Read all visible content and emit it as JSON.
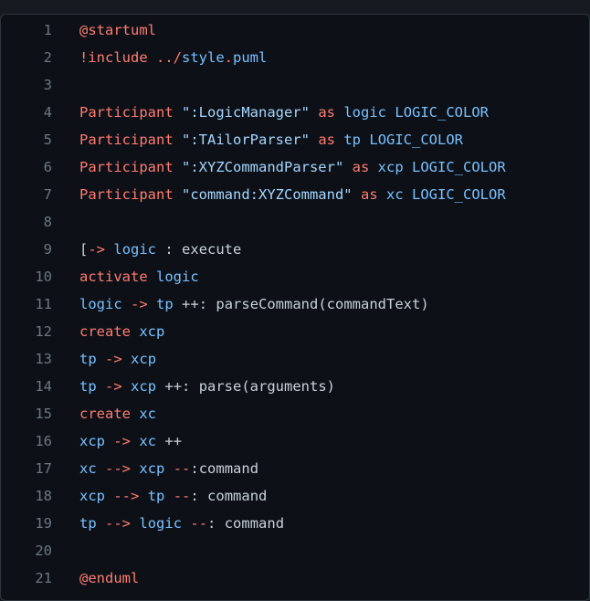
{
  "editor": {
    "language": "plantuml",
    "colors": {
      "background": "#0d1117",
      "keyword": "#ff7b72",
      "identifier": "#79c0ff",
      "string": "#a5d6ff",
      "default": "#c9d1d9",
      "line_number": "#6e7681"
    },
    "lines": [
      {
        "n": "1",
        "tokens": [
          {
            "t": "@startuml",
            "c": "k"
          }
        ]
      },
      {
        "n": "2",
        "tokens": [
          {
            "t": "!include",
            "c": "k"
          },
          {
            "t": " ",
            "c": "d"
          },
          {
            "t": "../",
            "c": "k"
          },
          {
            "t": "style",
            "c": "b"
          },
          {
            "t": ".",
            "c": "k"
          },
          {
            "t": "puml",
            "c": "b"
          }
        ]
      },
      {
        "n": "3",
        "tokens": []
      },
      {
        "n": "4",
        "tokens": [
          {
            "t": "Participant",
            "c": "k"
          },
          {
            "t": " ",
            "c": "d"
          },
          {
            "t": "\":LogicManager\"",
            "c": "s"
          },
          {
            "t": " ",
            "c": "d"
          },
          {
            "t": "as",
            "c": "k"
          },
          {
            "t": " ",
            "c": "d"
          },
          {
            "t": "logic",
            "c": "b"
          },
          {
            "t": " ",
            "c": "d"
          },
          {
            "t": "LOGIC_COLOR",
            "c": "b"
          }
        ]
      },
      {
        "n": "5",
        "tokens": [
          {
            "t": "Participant",
            "c": "k"
          },
          {
            "t": " ",
            "c": "d"
          },
          {
            "t": "\":TAilorParser\"",
            "c": "s"
          },
          {
            "t": " ",
            "c": "d"
          },
          {
            "t": "as",
            "c": "k"
          },
          {
            "t": " ",
            "c": "d"
          },
          {
            "t": "tp",
            "c": "b"
          },
          {
            "t": " ",
            "c": "d"
          },
          {
            "t": "LOGIC_COLOR",
            "c": "b"
          }
        ]
      },
      {
        "n": "6",
        "tokens": [
          {
            "t": "Participant",
            "c": "k"
          },
          {
            "t": " ",
            "c": "d"
          },
          {
            "t": "\":XYZCommandParser\"",
            "c": "s"
          },
          {
            "t": " ",
            "c": "d"
          },
          {
            "t": "as",
            "c": "k"
          },
          {
            "t": " ",
            "c": "d"
          },
          {
            "t": "xcp",
            "c": "b"
          },
          {
            "t": " ",
            "c": "d"
          },
          {
            "t": "LOGIC_COLOR",
            "c": "b"
          }
        ]
      },
      {
        "n": "7",
        "tokens": [
          {
            "t": "Participant",
            "c": "k"
          },
          {
            "t": " ",
            "c": "d"
          },
          {
            "t": "\"command:XYZCommand\"",
            "c": "s"
          },
          {
            "t": " ",
            "c": "d"
          },
          {
            "t": "as",
            "c": "k"
          },
          {
            "t": " ",
            "c": "d"
          },
          {
            "t": "xc",
            "c": "b"
          },
          {
            "t": " ",
            "c": "d"
          },
          {
            "t": "LOGIC_COLOR",
            "c": "b"
          }
        ]
      },
      {
        "n": "8",
        "tokens": []
      },
      {
        "n": "9",
        "tokens": [
          {
            "t": "[",
            "c": "d"
          },
          {
            "t": "->",
            "c": "k"
          },
          {
            "t": " ",
            "c": "d"
          },
          {
            "t": "logic",
            "c": "b"
          },
          {
            "t": " : execute",
            "c": "d"
          }
        ]
      },
      {
        "n": "10",
        "tokens": [
          {
            "t": "activate",
            "c": "k"
          },
          {
            "t": " ",
            "c": "d"
          },
          {
            "t": "logic",
            "c": "b"
          }
        ]
      },
      {
        "n": "11",
        "tokens": [
          {
            "t": "logic",
            "c": "b"
          },
          {
            "t": " ",
            "c": "d"
          },
          {
            "t": "->",
            "c": "k"
          },
          {
            "t": " ",
            "c": "d"
          },
          {
            "t": "tp",
            "c": "b"
          },
          {
            "t": " ++: parseCommand(commandText)",
            "c": "d"
          }
        ]
      },
      {
        "n": "12",
        "tokens": [
          {
            "t": "create",
            "c": "k"
          },
          {
            "t": " ",
            "c": "d"
          },
          {
            "t": "xcp",
            "c": "b"
          }
        ]
      },
      {
        "n": "13",
        "tokens": [
          {
            "t": "tp",
            "c": "b"
          },
          {
            "t": " ",
            "c": "d"
          },
          {
            "t": "->",
            "c": "k"
          },
          {
            "t": " ",
            "c": "d"
          },
          {
            "t": "xcp",
            "c": "b"
          }
        ]
      },
      {
        "n": "14",
        "tokens": [
          {
            "t": "tp",
            "c": "b"
          },
          {
            "t": " ",
            "c": "d"
          },
          {
            "t": "->",
            "c": "k"
          },
          {
            "t": " ",
            "c": "d"
          },
          {
            "t": "xcp",
            "c": "b"
          },
          {
            "t": " ++: parse(arguments)",
            "c": "d"
          }
        ]
      },
      {
        "n": "15",
        "tokens": [
          {
            "t": "create",
            "c": "k"
          },
          {
            "t": " ",
            "c": "d"
          },
          {
            "t": "xc",
            "c": "b"
          }
        ]
      },
      {
        "n": "16",
        "tokens": [
          {
            "t": "xcp",
            "c": "b"
          },
          {
            "t": " ",
            "c": "d"
          },
          {
            "t": "->",
            "c": "k"
          },
          {
            "t": " ",
            "c": "d"
          },
          {
            "t": "xc",
            "c": "b"
          },
          {
            "t": " ++",
            "c": "d"
          }
        ]
      },
      {
        "n": "17",
        "tokens": [
          {
            "t": "xc",
            "c": "b"
          },
          {
            "t": " ",
            "c": "d"
          },
          {
            "t": "-->",
            "c": "k"
          },
          {
            "t": " ",
            "c": "d"
          },
          {
            "t": "xcp",
            "c": "b"
          },
          {
            "t": " ",
            "c": "d"
          },
          {
            "t": "--",
            "c": "k"
          },
          {
            "t": ":command",
            "c": "d"
          }
        ]
      },
      {
        "n": "18",
        "tokens": [
          {
            "t": "xcp",
            "c": "b"
          },
          {
            "t": " ",
            "c": "d"
          },
          {
            "t": "-->",
            "c": "k"
          },
          {
            "t": " ",
            "c": "d"
          },
          {
            "t": "tp",
            "c": "b"
          },
          {
            "t": " ",
            "c": "d"
          },
          {
            "t": "--",
            "c": "k"
          },
          {
            "t": ": command",
            "c": "d"
          }
        ]
      },
      {
        "n": "19",
        "tokens": [
          {
            "t": "tp",
            "c": "b"
          },
          {
            "t": " ",
            "c": "d"
          },
          {
            "t": "-->",
            "c": "k"
          },
          {
            "t": " ",
            "c": "d"
          },
          {
            "t": "logic",
            "c": "b"
          },
          {
            "t": " ",
            "c": "d"
          },
          {
            "t": "--",
            "c": "k"
          },
          {
            "t": ": command",
            "c": "d"
          }
        ]
      },
      {
        "n": "20",
        "tokens": []
      },
      {
        "n": "21",
        "tokens": [
          {
            "t": "@enduml",
            "c": "k"
          }
        ]
      }
    ]
  }
}
